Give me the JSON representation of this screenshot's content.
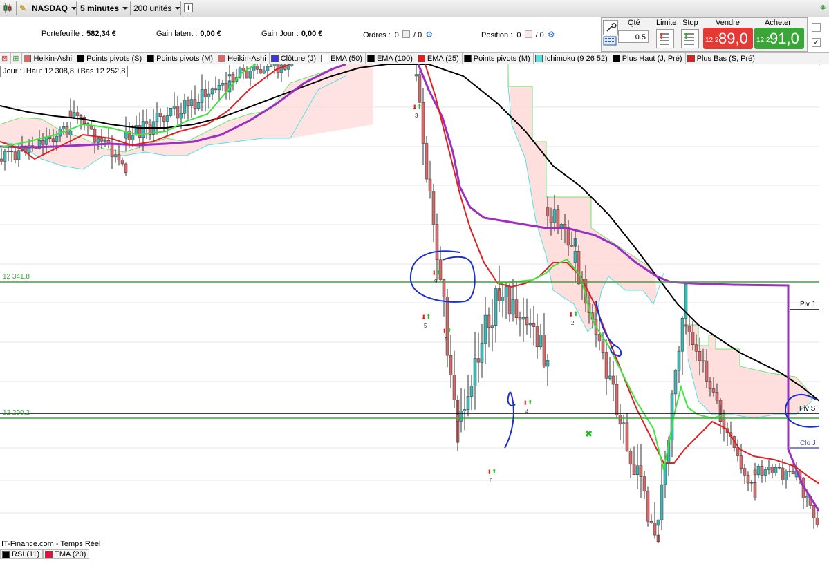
{
  "toolbar": {
    "instrument": "NASDAQ",
    "timeframe": "5 minutes",
    "units": "200 unités",
    "info_icon": "i"
  },
  "account": {
    "portfolio_label": "Portefeuille :",
    "portfolio_value": "582,34 €",
    "latent_label": "Gain latent :",
    "latent_value": "0,00 €",
    "day_label": "Gain Jour :",
    "day_value": "0,00 €",
    "orders_label": "Ordres :",
    "orders_a": "0",
    "orders_b": "/ 0",
    "position_label": "Position :",
    "position_a": "0",
    "position_b": "/ 0"
  },
  "order_panel": {
    "qty_label": "Qté",
    "qty_value": "0.5",
    "limit_label": "Limite",
    "stop_label": "Stop",
    "sell_label": "Vendre",
    "sell_small": "12 2",
    "sell_big": "89,0",
    "buy_label": "Acheter",
    "buy_small": "12 2",
    "buy_big": "91,0"
  },
  "indicators": [
    {
      "label": "Heikin-Ashi",
      "color": "#d46a6a"
    },
    {
      "label": "Points pivots (S)",
      "color": "#000000"
    },
    {
      "label": "Points pivots (M)",
      "color": "#000000"
    },
    {
      "label": "Heikin-Ashi",
      "color": "#d46a6a"
    },
    {
      "label": "Clôture (J)",
      "color": "#3a3ad0"
    },
    {
      "label": "EMA (50)",
      "color": "#ffffff"
    },
    {
      "label": "EMA (100)",
      "color": "#000000"
    },
    {
      "label": "EMA (25)",
      "color": "#e02020"
    },
    {
      "label": "Points pivots (M)",
      "color": "#000000"
    },
    {
      "label": "Ichimoku (9 26 52)",
      "color": "#4fe3e3"
    },
    {
      "label": "Plus Haut (J, Pré)",
      "color": "#000000"
    },
    {
      "label": "Plus Bas (S, Pré)",
      "color": "#e02020"
    }
  ],
  "chart": {
    "day_info": "Jour :+Haut 12 308,8 +Bas 12 252,8",
    "price_line_1": "12 341,8",
    "price_line_2": "12 290,2",
    "piv_j": "Piv J",
    "piv_s": "Piv S",
    "clo_j": "Clo J",
    "signal_numbers": [
      "3",
      "9",
      "5",
      "5",
      "2",
      "4",
      "6"
    ],
    "source": "IT-Finance.com - Temps Réel"
  },
  "lower_panel": [
    {
      "label": "RSI (11)",
      "color": "#000000"
    },
    {
      "label": "TMA (20)",
      "color": "#e8103a"
    }
  ]
}
